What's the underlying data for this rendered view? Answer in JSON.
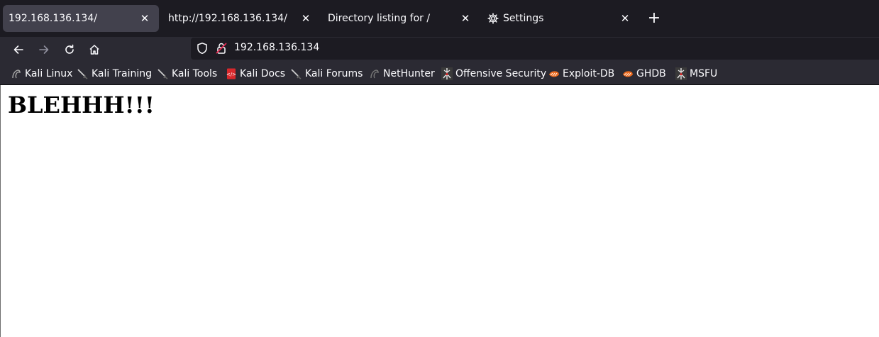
{
  "tabs": [
    {
      "label": "192.168.136.134/",
      "active": true
    },
    {
      "label": "http://192.168.136.134/",
      "active": false
    },
    {
      "label": "Directory listing for /",
      "active": false
    },
    {
      "label": "Settings",
      "active": false,
      "icon": "gear-icon"
    }
  ],
  "newtab_label": "+",
  "urlbar": {
    "url": "192.168.136.134"
  },
  "bookmarks": [
    {
      "label": "Kali Linux",
      "icon": "kali-dragon-icon"
    },
    {
      "label": "Kali Training",
      "icon": "kali-sword-icon"
    },
    {
      "label": "Kali Tools",
      "icon": "kali-sword-icon"
    },
    {
      "label": "Kali Docs",
      "icon": "docs-icon"
    },
    {
      "label": "Kali Forums",
      "icon": "kali-sword-icon"
    },
    {
      "label": "NetHunter",
      "icon": "kali-dragon-icon"
    },
    {
      "label": "Offensive Security",
      "icon": "offsec-icon"
    },
    {
      "label": "Exploit-DB",
      "icon": "exploitdb-icon"
    },
    {
      "label": "GHDB",
      "icon": "exploitdb-icon"
    },
    {
      "label": "MSFU",
      "icon": "offsec-icon"
    }
  ],
  "page": {
    "heading": "BLEHHH!!!"
  },
  "colors": {
    "tabbar": "#1c1b22",
    "toolbar": "#2b2a33",
    "active_tab": "#42414d",
    "text": "#fbfbfe",
    "page_bg": "#ffffff"
  }
}
